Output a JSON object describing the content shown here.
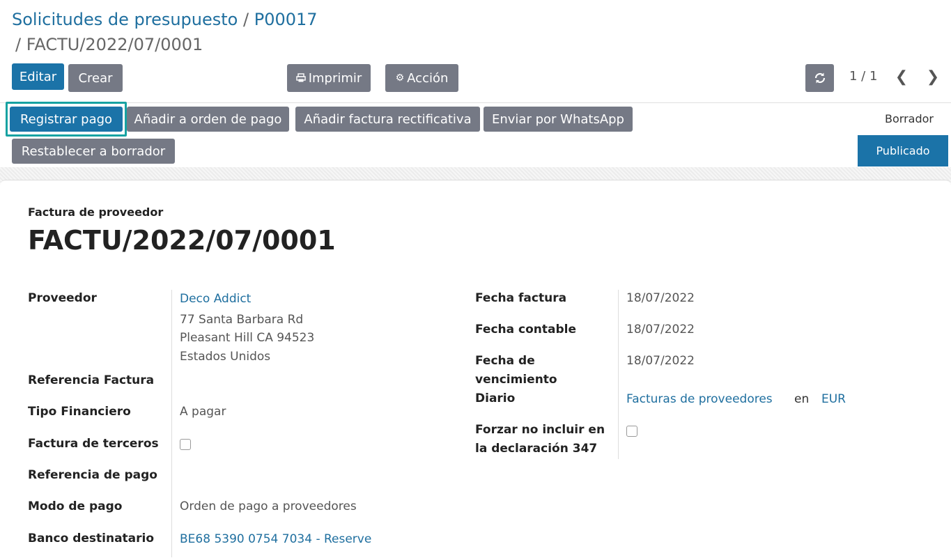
{
  "breadcrumb": {
    "parent": "Solicitudes de presupuesto",
    "separator": "/",
    "order": "P00017",
    "current": "FACTU/2022/07/0001"
  },
  "toolbar": {
    "edit": "Editar",
    "create": "Crear",
    "print": "Imprimir",
    "action": "Acción",
    "pager": "1 / 1"
  },
  "actions": {
    "register_payment": "Registrar pago",
    "add_payment_order": "Añadir a orden de pago",
    "add_credit_note": "Añadir factura rectificativa",
    "send_whatsapp": "Enviar por WhatsApp",
    "reset_draft": "Restablecer a borrador"
  },
  "status": {
    "draft": "Borrador",
    "posted": "Publicado"
  },
  "document": {
    "type": "Factura de proveedor",
    "name": "FACTU/2022/07/0001"
  },
  "left_fields": {
    "vendor_label": "Proveedor",
    "vendor_name": "Deco Addict",
    "vendor_address": [
      "77 Santa Barbara Rd",
      "Pleasant Hill CA 94523",
      "Estados Unidos"
    ],
    "ref_label": "Referencia Factura",
    "fin_type_label": "Tipo Financiero",
    "fin_type_value": "A pagar",
    "third_party_label": "Factura de terceros",
    "payment_ref_label": "Referencia de pago",
    "payment_mode_label": "Modo de pago",
    "payment_mode_value": "Orden de pago a proveedores",
    "bank_label": "Banco destinatario",
    "bank_value": "BE68 5390 0754 7034 - Reserve"
  },
  "right_fields": {
    "invoice_date_label": "Fecha factura",
    "invoice_date": "18/07/2022",
    "accounting_date_label": "Fecha contable",
    "accounting_date": "18/07/2022",
    "due_date_label_1": "Fecha de",
    "due_date_label_2": "vencimiento",
    "due_date": "18/07/2022",
    "journal_label": "Diario",
    "journal_value": "Facturas de proveedores",
    "journal_in": "en",
    "currency": "EUR",
    "force_label_1": "Forzar no incluir en",
    "force_label_2": "la declaración 347"
  }
}
